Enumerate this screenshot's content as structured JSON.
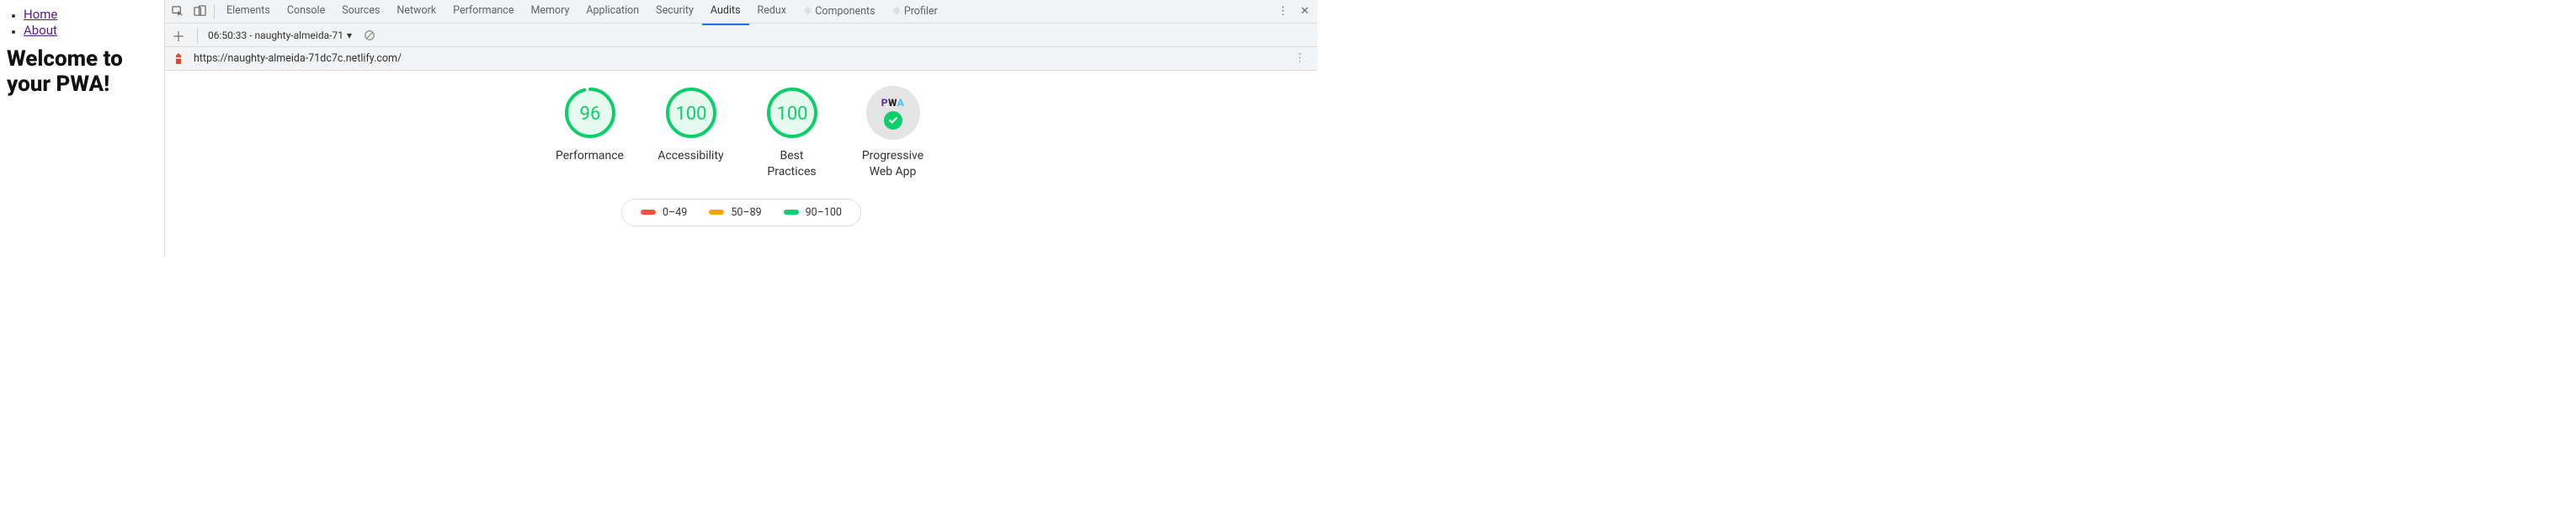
{
  "page": {
    "nav": [
      "Home",
      "About"
    ],
    "heading": "Welcome to your PWA!"
  },
  "devtools": {
    "tabs": [
      "Elements",
      "Console",
      "Sources",
      "Network",
      "Performance",
      "Memory",
      "Application",
      "Security",
      "Audits",
      "Redux",
      "⚛ Components",
      "⚛ Profiler"
    ],
    "active_tab": "Audits",
    "audits": {
      "run_label": "06:50:33 - naughty-almeida-71",
      "url": "https://naughty-almeida-71dc7c.netlify.com/",
      "scores": [
        {
          "label": "Performance",
          "value": 96
        },
        {
          "label": "Accessibility",
          "value": 100
        },
        {
          "label": "Best Practices",
          "value": 100
        }
      ],
      "pwa_label": "Progressive Web App",
      "pwa_text": "PWA",
      "legend": [
        {
          "range": "0–49",
          "color": "bad"
        },
        {
          "range": "50–89",
          "color": "mid"
        },
        {
          "range": "90–100",
          "color": "good"
        }
      ]
    }
  }
}
